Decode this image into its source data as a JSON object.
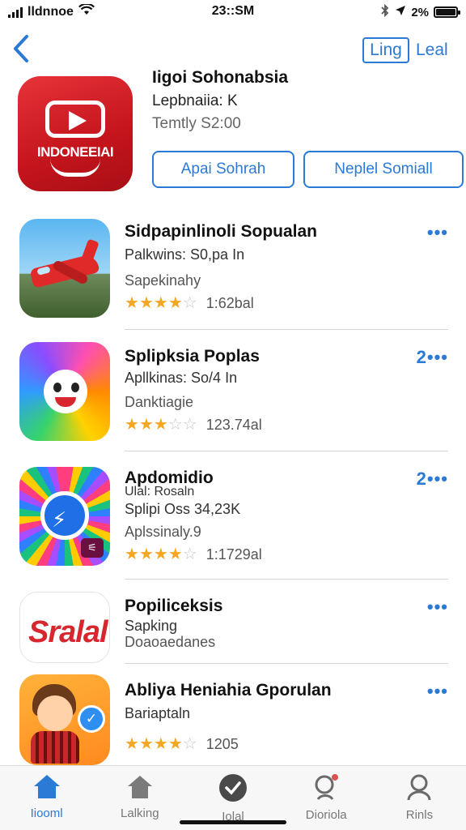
{
  "status_bar": {
    "carrier": "lldnnoe",
    "time": "23::SM",
    "battery": "2%",
    "icons": [
      "signal-icon",
      "wifi-icon",
      "bluetooth-icon",
      "location-icon",
      "battery-icon"
    ]
  },
  "header": {
    "back_icon": "chevron-left-icon",
    "button_boxed": "Ling",
    "button_plain": "Leal"
  },
  "featured": {
    "icon_text": "INDONEEIAI",
    "title": "Iigoi Sohonabsia",
    "subtitle": "Lepbnaiia: K",
    "price": "Temtly S2:00",
    "action_primary": "Apai Sohrah",
    "action_secondary": "Neplel Somiall"
  },
  "apps": [
    {
      "name": "Sidpapinlinoli Sopualan",
      "meta": "Palkwins: S0,pa In",
      "category": "Sapekinahy",
      "rating": 4,
      "rating_count": "1:62bal",
      "more": "•••"
    },
    {
      "name": "Splipksia Poplas",
      "meta": "Apllkinas: So/4 In",
      "category": "Danktiagie",
      "rating": 3,
      "rating_count": "123.74al",
      "more": "2•••"
    },
    {
      "name": "Apdomidio",
      "subname": "Ulal: Rosaln",
      "meta": "Splipi Oss 34,23K",
      "category": "Aplssinaly.9",
      "rating": 4,
      "rating_count": "1:1729al",
      "more": "2•••"
    },
    {
      "name": "Popiliceksis",
      "meta": "Sapking",
      "category": "Doaoaedanes",
      "more": "•••",
      "icon_text": "Sralal"
    },
    {
      "name": "Abliya Heniahia Gporulan",
      "meta": "Bariaptaln",
      "rating": 4,
      "rating_count": "1205",
      "more": "•••"
    }
  ],
  "tabs": [
    {
      "label": "Iiooml",
      "icon": "home-icon",
      "active": true
    },
    {
      "label": "Lalking",
      "icon": "house-icon",
      "active": false
    },
    {
      "label": "Iolal",
      "icon": "check-circle-icon",
      "active": false
    },
    {
      "label": "Dioriola",
      "icon": "search-icon",
      "active": false
    },
    {
      "label": "Rinls",
      "icon": "person-icon",
      "active": false
    }
  ],
  "colors": {
    "accent": "#2a7ad6",
    "star": "#f5a623",
    "featured_icon": "#d21a22"
  }
}
